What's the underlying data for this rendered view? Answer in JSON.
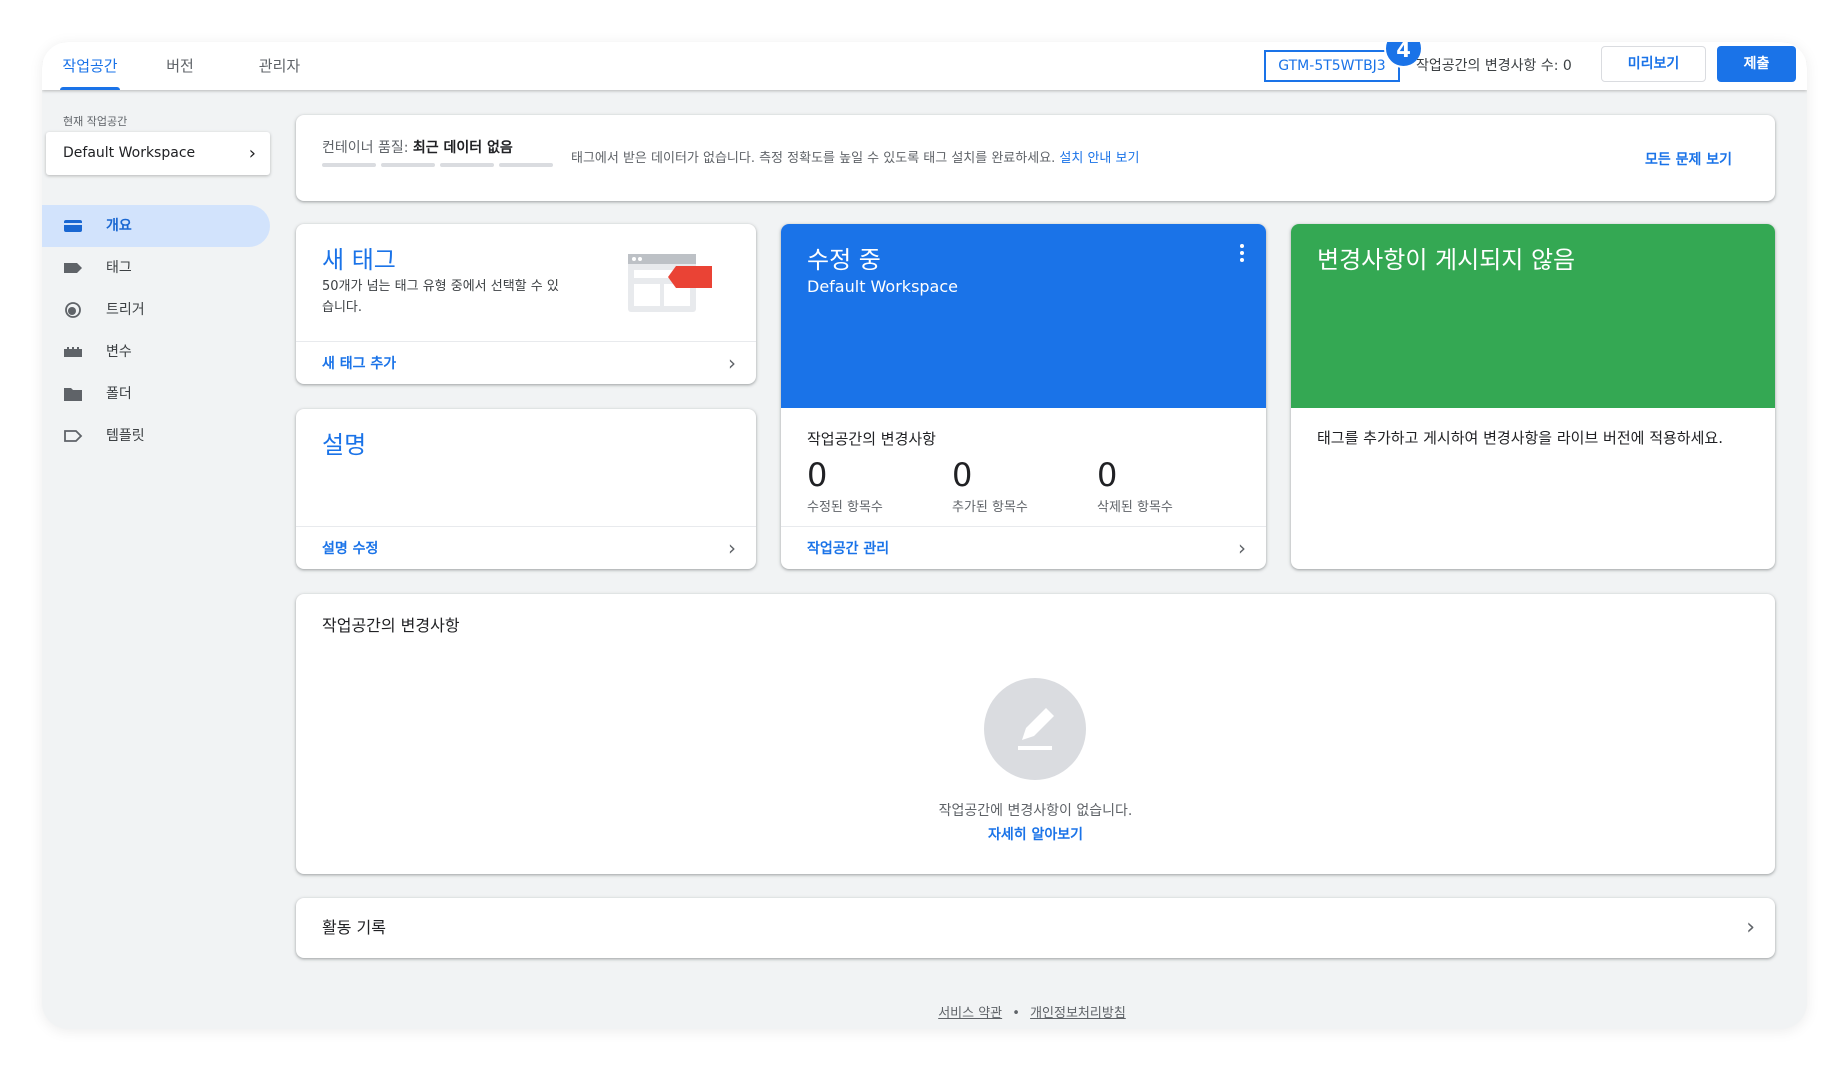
{
  "header": {
    "tabs": [
      {
        "label": "작업공간",
        "active": true
      },
      {
        "label": "버전",
        "active": false
      },
      {
        "label": "관리자",
        "active": false
      }
    ],
    "container_id": "GTM-5T5WTBJ3",
    "step_badge": "4",
    "workspace_changes": "작업공간의 변경사항 수: 0",
    "preview_label": "미리보기",
    "submit_label": "제출",
    "accent_color": "#1a73e8"
  },
  "sidebar": {
    "current_workspace_label": "현재 작업공간",
    "workspace_name": "Default Workspace",
    "items": [
      {
        "label": "개요",
        "icon": "overview-icon",
        "active": true
      },
      {
        "label": "태그",
        "icon": "tag-icon",
        "active": false
      },
      {
        "label": "트리거",
        "icon": "trigger-icon",
        "active": false
      },
      {
        "label": "변수",
        "icon": "variable-icon",
        "active": false
      },
      {
        "label": "폴더",
        "icon": "folder-icon",
        "active": false
      },
      {
        "label": "템플릿",
        "icon": "template-icon",
        "active": false
      }
    ]
  },
  "quality": {
    "label": "컨테이너 품질:",
    "value": "최근 데이터 없음",
    "message": "태그에서 받은 데이터가 없습니다. 측정 정확도를 높일 수 있도록 태그 설치를 완료하세요.",
    "guide_link": "설치 안내 보기",
    "all_issues_link": "모든 문제 보기"
  },
  "new_tag_card": {
    "title": "새 태그",
    "description": "50개가 넘는 태그 유형 중에서 선택할 수 있습니다.",
    "action": "새 태그 추가"
  },
  "description_card": {
    "title": "설명",
    "action": "설명 수정"
  },
  "editing_card": {
    "title": "수정 중",
    "workspace": "Default Workspace",
    "changes_title": "작업공간의 변경사항",
    "stats": [
      {
        "value": "0",
        "label": "수정된 항목수"
      },
      {
        "value": "0",
        "label": "추가된 항목수"
      },
      {
        "value": "0",
        "label": "삭제된 항목수"
      }
    ],
    "action": "작업공간 관리",
    "color": "#1a73e8"
  },
  "unpublished_card": {
    "title": "변경사항이 게시되지 않음",
    "message": "태그를 추가하고 게시하여 변경사항을 라이브 버전에 적용하세요.",
    "color": "#34a853"
  },
  "changes_panel": {
    "title": "작업공간의 변경사항",
    "empty_text": "작업공간에 변경사항이 없습니다.",
    "learn_more": "자세히 알아보기"
  },
  "activity": {
    "title": "활동 기록"
  },
  "footer": {
    "terms": "서비스 약관",
    "separator": "•",
    "privacy": "개인정보처리방침"
  }
}
